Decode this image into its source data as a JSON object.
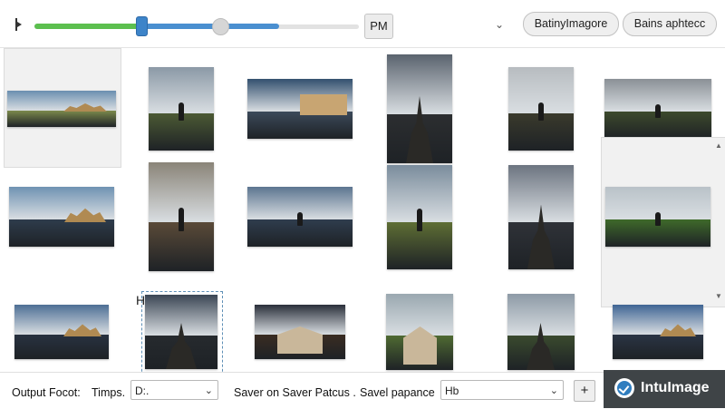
{
  "toolbar": {
    "pm_label": "PM",
    "buttons": [
      "BatinyImagore",
      "Bains aphtecc"
    ]
  },
  "gallery": {
    "stray_glyph": "H",
    "thumbnails": [
      {
        "name": "lake-castle-landscape",
        "sky": "#6a8fb0",
        "ground": "#7c8a4c",
        "subject": "castle",
        "selected": true
      },
      {
        "name": "forest-figure-portrait",
        "sky": "#8b99a6",
        "ground": "#4c5a34",
        "subject": "figure"
      },
      {
        "name": "canal-palace-landscape",
        "sky": "#33506f",
        "ground": "#3c4a5a",
        "subject": "palace"
      },
      {
        "name": "cathedral-tower-portrait",
        "sky": "#5a636e",
        "ground": "#2c2e30",
        "subject": "tower"
      },
      {
        "name": "sunlit-forest-figure",
        "sky": "#b7bcc0",
        "ground": "#3a3a2c",
        "subject": "figure"
      },
      {
        "name": "dark-forest-figure",
        "sky": "#8a9096",
        "ground": "#3d4a2c",
        "subject": "figure"
      },
      {
        "name": "mountain-lake-reflection",
        "sky": "#6f92b2",
        "ground": "#2e3c4c",
        "subject": "castle"
      },
      {
        "name": "old-street-figure",
        "sky": "#8a8478",
        "ground": "#5a4a38",
        "subject": "figure"
      },
      {
        "name": "pier-figure-lake",
        "sky": "#5c7590",
        "ground": "#2f3d4e",
        "subject": "figure"
      },
      {
        "name": "forest-path-figure",
        "sky": "#7a8c9c",
        "ground": "#5e6e34",
        "subject": "figure"
      },
      {
        "name": "church-tower-clouds",
        "sky": "#6c7480",
        "ground": "#2f3238",
        "subject": "tower"
      },
      {
        "name": "alpine-lake-meadow",
        "sky": "#b9c2c8",
        "ground": "#3f6a2a",
        "subject": "figure",
        "scroll": true
      },
      {
        "name": "sunset-shore-castle",
        "sky": "#4d6f95",
        "ground": "#283240",
        "subject": "castle"
      },
      {
        "name": "dark-tower-night",
        "sky": "#3b4654",
        "ground": "#262a2e",
        "subject": "tower",
        "dotted": true
      },
      {
        "name": "lit-chapel-night",
        "sky": "#2a2f3a",
        "ground": "#3a2c22",
        "subject": "chapel"
      },
      {
        "name": "mountain-chapel",
        "sky": "#9aa8b0",
        "ground": "#4f6a32",
        "subject": "chapel"
      },
      {
        "name": "forest-cathedral",
        "sky": "#8d9aa6",
        "ground": "#3a4a2e",
        "subject": "tower"
      },
      {
        "name": "coastal-castle-dusk",
        "sky": "#3f6594",
        "ground": "#2a3444",
        "subject": "castle"
      }
    ]
  },
  "bottombar": {
    "output_label": "Output Focot:",
    "timps_label": "Timps.",
    "timps_value": "D:.",
    "saver_label": "Saver on Saver Patcus .",
    "savel_label": "Savel papance",
    "savel_value": "Hb",
    "plus_label": "+"
  },
  "brand": {
    "name": "IntuImage",
    "color": "#3f4447",
    "accent": "#2f7dbf"
  }
}
